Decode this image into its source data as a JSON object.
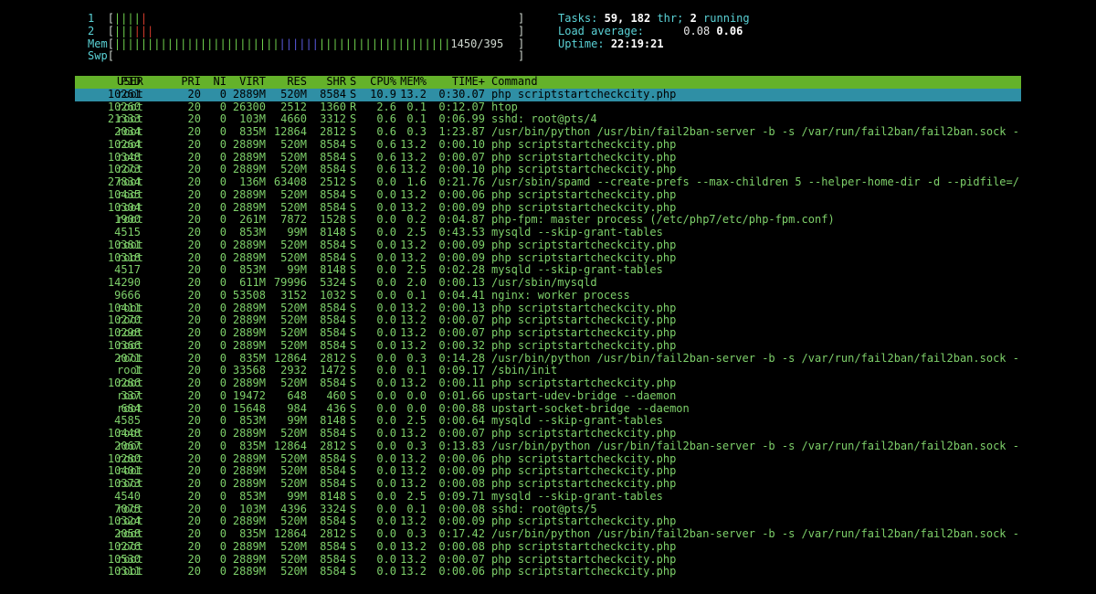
{
  "meters": {
    "cpu1": {
      "label": "1",
      "open": "[",
      "green": "||||",
      "red": "|",
      "close": "]"
    },
    "cpu2": {
      "label": "2",
      "open": "[",
      "green": "|||",
      "red": "|||",
      "close": "]"
    },
    "mem": {
      "label": "Mem",
      "open": "[",
      "green1": "|||||||||||||||||||||||||",
      "blue": "||||||",
      "yellow": "",
      "green2": "||||||||||||||||||||",
      "value": "1450/395",
      "close": "]"
    },
    "swp": {
      "label": "Swp",
      "open": "[",
      "close": "]"
    }
  },
  "stats": {
    "tasks_label": "Tasks:",
    "tasks_value": "59,",
    "threads_value": "182",
    "threads_label": "thr;",
    "running_value": "2",
    "running_label": "running",
    "load_label": "Load average:",
    "load1": "0.08",
    "load5": "0.06",
    "uptime_label": "Uptime:",
    "uptime_value": "22:19:21"
  },
  "colors": {
    "header_bg": "#64b22a",
    "selected_bg": "#2f8fa5",
    "text_green": "#7ed06a"
  },
  "columns": [
    "PID",
    "USER",
    "PRI",
    "NI",
    "VIRT",
    "RES",
    "SHR",
    "S",
    "CPU%",
    "MEM%",
    "TIME+",
    "Command"
  ],
  "processes": [
    {
      "pid": "10261",
      "user": "root",
      "pri": "20",
      "ni": "0",
      "virt": "2889M",
      "res": "520M",
      "shr": "8584",
      "s": "S",
      "cpu": "10.9",
      "mem": "13.2",
      "time": "0:30.07",
      "cmd": "php scriptstartcheckcity.php"
    },
    {
      "pid": "10260",
      "user": "root",
      "pri": "20",
      "ni": "0",
      "virt": "26300",
      "res": "2512",
      "shr": "1360",
      "s": "R",
      "cpu": "2.6",
      "mem": "0.1",
      "time": "0:12.07",
      "cmd": "htop"
    },
    {
      "pid": "21333",
      "user": "root",
      "pri": "20",
      "ni": "0",
      "virt": "103M",
      "res": "4660",
      "shr": "3312",
      "s": "S",
      "cpu": "0.6",
      "mem": "0.1",
      "time": "0:06.99",
      "cmd": "sshd: root@pts/4"
    },
    {
      "pid": "2034",
      "user": "root",
      "pri": "20",
      "ni": "0",
      "virt": "835M",
      "res": "12864",
      "shr": "2812",
      "s": "S",
      "cpu": "0.6",
      "mem": "0.3",
      "time": "1:23.87",
      "cmd": "/usr/bin/python /usr/bin/fail2ban-server -b -s /var/run/fail2ban/fail2ban.sock -"
    },
    {
      "pid": "10264",
      "user": "root",
      "pri": "20",
      "ni": "0",
      "virt": "2889M",
      "res": "520M",
      "shr": "8584",
      "s": "S",
      "cpu": "0.6",
      "mem": "13.2",
      "time": "0:00.10",
      "cmd": "php scriptstartcheckcity.php"
    },
    {
      "pid": "10348",
      "user": "root",
      "pri": "20",
      "ni": "0",
      "virt": "2889M",
      "res": "520M",
      "shr": "8584",
      "s": "S",
      "cpu": "0.6",
      "mem": "13.2",
      "time": "0:00.07",
      "cmd": "php scriptstartcheckcity.php"
    },
    {
      "pid": "10273",
      "user": "root",
      "pri": "20",
      "ni": "0",
      "virt": "2889M",
      "res": "520M",
      "shr": "8584",
      "s": "S",
      "cpu": "0.6",
      "mem": "13.2",
      "time": "0:00.10",
      "cmd": "php scriptstartcheckcity.php"
    },
    {
      "pid": "27834",
      "user": "root",
      "pri": "20",
      "ni": "0",
      "virt": "136M",
      "res": "63408",
      "shr": "2512",
      "s": "S",
      "cpu": "0.0",
      "mem": "1.6",
      "time": "0:21.76",
      "cmd": "/usr/sbin/spamd --create-prefs --max-children 5 --helper-home-dir -d --pidfile=/"
    },
    {
      "pid": "10435",
      "user": "root",
      "pri": "20",
      "ni": "0",
      "virt": "2889M",
      "res": "520M",
      "shr": "8584",
      "s": "S",
      "cpu": "0.0",
      "mem": "13.2",
      "time": "0:00.06",
      "cmd": "php scriptstartcheckcity.php"
    },
    {
      "pid": "10304",
      "user": "root",
      "pri": "20",
      "ni": "0",
      "virt": "2889M",
      "res": "520M",
      "shr": "8584",
      "s": "S",
      "cpu": "0.0",
      "mem": "13.2",
      "time": "0:00.09",
      "cmd": "php scriptstartcheckcity.php"
    },
    {
      "pid": "1900",
      "user": "root",
      "pri": "20",
      "ni": "0",
      "virt": "261M",
      "res": "7872",
      "shr": "1528",
      "s": "S",
      "cpu": "0.0",
      "mem": "0.2",
      "time": "0:04.87",
      "cmd": "php-fpm: master process (/etc/php7/etc/php-fpm.conf)"
    },
    {
      "pid": "4515",
      "user": "",
      "pri": "20",
      "ni": "0",
      "virt": "853M",
      "res": "99M",
      "shr": "8148",
      "s": "S",
      "cpu": "0.0",
      "mem": "2.5",
      "time": "0:43.53",
      "cmd": "mysqld --skip-grant-tables"
    },
    {
      "pid": "10381",
      "user": "root",
      "pri": "20",
      "ni": "0",
      "virt": "2889M",
      "res": "520M",
      "shr": "8584",
      "s": "S",
      "cpu": "0.0",
      "mem": "13.2",
      "time": "0:00.09",
      "cmd": "php scriptstartcheckcity.php"
    },
    {
      "pid": "10318",
      "user": "root",
      "pri": "20",
      "ni": "0",
      "virt": "2889M",
      "res": "520M",
      "shr": "8584",
      "s": "S",
      "cpu": "0.0",
      "mem": "13.2",
      "time": "0:00.09",
      "cmd": "php scriptstartcheckcity.php"
    },
    {
      "pid": "4517",
      "user": "",
      "pri": "20",
      "ni": "0",
      "virt": "853M",
      "res": "99M",
      "shr": "8148",
      "s": "S",
      "cpu": "0.0",
      "mem": "2.5",
      "time": "0:02.28",
      "cmd": "mysqld --skip-grant-tables"
    },
    {
      "pid": "14290",
      "user": "",
      "pri": "20",
      "ni": "0",
      "virt": "611M",
      "res": "79996",
      "shr": "5324",
      "s": "S",
      "cpu": "0.0",
      "mem": "2.0",
      "time": "0:00.13",
      "cmd": "/usr/sbin/mysqld"
    },
    {
      "pid": "9666",
      "user": "",
      "pri": "20",
      "ni": "0",
      "virt": "53508",
      "res": "3152",
      "shr": "1032",
      "s": "S",
      "cpu": "0.0",
      "mem": "0.1",
      "time": "0:04.41",
      "cmd": "nginx: worker process"
    },
    {
      "pid": "10411",
      "user": "root",
      "pri": "20",
      "ni": "0",
      "virt": "2889M",
      "res": "520M",
      "shr": "8584",
      "s": "S",
      "cpu": "0.0",
      "mem": "13.2",
      "time": "0:00.13",
      "cmd": "php scriptstartcheckcity.php"
    },
    {
      "pid": "10270",
      "user": "root",
      "pri": "20",
      "ni": "0",
      "virt": "2889M",
      "res": "520M",
      "shr": "8584",
      "s": "S",
      "cpu": "0.0",
      "mem": "13.2",
      "time": "0:00.07",
      "cmd": "php scriptstartcheckcity.php"
    },
    {
      "pid": "10298",
      "user": "root",
      "pri": "20",
      "ni": "0",
      "virt": "2889M",
      "res": "520M",
      "shr": "8584",
      "s": "S",
      "cpu": "0.0",
      "mem": "13.2",
      "time": "0:00.07",
      "cmd": "php scriptstartcheckcity.php"
    },
    {
      "pid": "10366",
      "user": "root",
      "pri": "20",
      "ni": "0",
      "virt": "2889M",
      "res": "520M",
      "shr": "8584",
      "s": "S",
      "cpu": "0.0",
      "mem": "13.2",
      "time": "0:00.32",
      "cmd": "php scriptstartcheckcity.php"
    },
    {
      "pid": "2071",
      "user": "root",
      "pri": "20",
      "ni": "0",
      "virt": "835M",
      "res": "12864",
      "shr": "2812",
      "s": "S",
      "cpu": "0.0",
      "mem": "0.3",
      "time": "0:14.28",
      "cmd": "/usr/bin/python /usr/bin/fail2ban-server -b -s /var/run/fail2ban/fail2ban.sock -"
    },
    {
      "pid": "1",
      "user": "root",
      "pri": "20",
      "ni": "0",
      "virt": "33568",
      "res": "2932",
      "shr": "1472",
      "s": "S",
      "cpu": "0.0",
      "mem": "0.1",
      "time": "0:09.17",
      "cmd": "/sbin/init"
    },
    {
      "pid": "10286",
      "user": "root",
      "pri": "20",
      "ni": "0",
      "virt": "2889M",
      "res": "520M",
      "shr": "8584",
      "s": "S",
      "cpu": "0.0",
      "mem": "13.2",
      "time": "0:00.11",
      "cmd": "php scriptstartcheckcity.php"
    },
    {
      "pid": "337",
      "user": "root",
      "pri": "20",
      "ni": "0",
      "virt": "19472",
      "res": "648",
      "shr": "460",
      "s": "S",
      "cpu": "0.0",
      "mem": "0.0",
      "time": "0:01.66",
      "cmd": "upstart-udev-bridge --daemon"
    },
    {
      "pid": "684",
      "user": "root",
      "pri": "20",
      "ni": "0",
      "virt": "15648",
      "res": "984",
      "shr": "436",
      "s": "S",
      "cpu": "0.0",
      "mem": "0.0",
      "time": "0:00.88",
      "cmd": "upstart-socket-bridge --daemon"
    },
    {
      "pid": "4585",
      "user": "",
      "pri": "20",
      "ni": "0",
      "virt": "853M",
      "res": "99M",
      "shr": "8148",
      "s": "S",
      "cpu": "0.0",
      "mem": "2.5",
      "time": "0:00.64",
      "cmd": "mysqld --skip-grant-tables"
    },
    {
      "pid": "10448",
      "user": "root",
      "pri": "20",
      "ni": "0",
      "virt": "2889M",
      "res": "520M",
      "shr": "8584",
      "s": "S",
      "cpu": "0.0",
      "mem": "13.2",
      "time": "0:00.07",
      "cmd": "php scriptstartcheckcity.php"
    },
    {
      "pid": "2067",
      "user": "root",
      "pri": "20",
      "ni": "0",
      "virt": "835M",
      "res": "12864",
      "shr": "2812",
      "s": "S",
      "cpu": "0.0",
      "mem": "0.3",
      "time": "0:13.83",
      "cmd": "/usr/bin/python /usr/bin/fail2ban-server -b -s /var/run/fail2ban/fail2ban.sock -"
    },
    {
      "pid": "10280",
      "user": "root",
      "pri": "20",
      "ni": "0",
      "virt": "2889M",
      "res": "520M",
      "shr": "8584",
      "s": "S",
      "cpu": "0.0",
      "mem": "13.2",
      "time": "0:00.06",
      "cmd": "php scriptstartcheckcity.php"
    },
    {
      "pid": "10401",
      "user": "root",
      "pri": "20",
      "ni": "0",
      "virt": "2889M",
      "res": "520M",
      "shr": "8584",
      "s": "S",
      "cpu": "0.0",
      "mem": "13.2",
      "time": "0:00.09",
      "cmd": "php scriptstartcheckcity.php"
    },
    {
      "pid": "10373",
      "user": "root",
      "pri": "20",
      "ni": "0",
      "virt": "2889M",
      "res": "520M",
      "shr": "8584",
      "s": "S",
      "cpu": "0.0",
      "mem": "13.2",
      "time": "0:00.08",
      "cmd": "php scriptstartcheckcity.php"
    },
    {
      "pid": "4540",
      "user": "",
      "pri": "20",
      "ni": "0",
      "virt": "853M",
      "res": "99M",
      "shr": "8148",
      "s": "S",
      "cpu": "0.0",
      "mem": "2.5",
      "time": "0:09.71",
      "cmd": "mysqld --skip-grant-tables"
    },
    {
      "pid": "7075",
      "user": "root",
      "pri": "20",
      "ni": "0",
      "virt": "103M",
      "res": "4396",
      "shr": "3324",
      "s": "S",
      "cpu": "0.0",
      "mem": "0.1",
      "time": "0:00.08",
      "cmd": "sshd: root@pts/5"
    },
    {
      "pid": "10324",
      "user": "root",
      "pri": "20",
      "ni": "0",
      "virt": "2889M",
      "res": "520M",
      "shr": "8584",
      "s": "S",
      "cpu": "0.0",
      "mem": "13.2",
      "time": "0:00.09",
      "cmd": "php scriptstartcheckcity.php"
    },
    {
      "pid": "2058",
      "user": "root",
      "pri": "20",
      "ni": "0",
      "virt": "835M",
      "res": "12864",
      "shr": "2812",
      "s": "S",
      "cpu": "0.0",
      "mem": "0.3",
      "time": "0:17.42",
      "cmd": "/usr/bin/python /usr/bin/fail2ban-server -b -s /var/run/fail2ban/fail2ban.sock -"
    },
    {
      "pid": "10276",
      "user": "root",
      "pri": "20",
      "ni": "0",
      "virt": "2889M",
      "res": "520M",
      "shr": "8584",
      "s": "S",
      "cpu": "0.0",
      "mem": "13.2",
      "time": "0:00.08",
      "cmd": "php scriptstartcheckcity.php"
    },
    {
      "pid": "10530",
      "user": "root",
      "pri": "20",
      "ni": "0",
      "virt": "2889M",
      "res": "520M",
      "shr": "8584",
      "s": "S",
      "cpu": "0.0",
      "mem": "13.2",
      "time": "0:00.07",
      "cmd": "php scriptstartcheckcity.php"
    },
    {
      "pid": "10311",
      "user": "root",
      "pri": "20",
      "ni": "0",
      "virt": "2889M",
      "res": "520M",
      "shr": "8584",
      "s": "S",
      "cpu": "0.0",
      "mem": "13.2",
      "time": "0:00.06",
      "cmd": "php scriptstartcheckcity.php"
    }
  ]
}
